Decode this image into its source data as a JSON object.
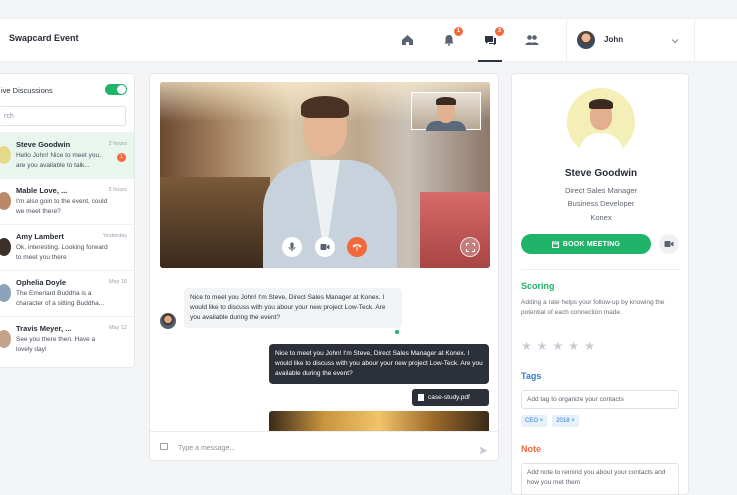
{
  "header": {
    "brand": "Swapcard Event",
    "nav": [
      {
        "icon": "home-icon"
      },
      {
        "icon": "bell-icon",
        "badge": "1"
      },
      {
        "icon": "chat-icon",
        "badge": "3"
      },
      {
        "icon": "people-icon"
      }
    ],
    "user": {
      "name": "John"
    }
  },
  "discussions": {
    "title": "ive Discussions",
    "live_toggle": true,
    "search_placeholder": "rch",
    "items": [
      {
        "name": "Steve Goodwin",
        "time": "2 hours",
        "message": "Hello John! Nice to meet you, are you available to talk...",
        "unread": "1",
        "active": true
      },
      {
        "name": "Mable Love, ...",
        "time": "5 hours",
        "message": "I'm also goin to the event, could we meet there?"
      },
      {
        "name": "Amy Lambert",
        "time": "Yesterday",
        "message": "Ok, interesting. Looking forward to meet you there"
      },
      {
        "name": "Ophelia Doyle",
        "time": "May 18",
        "message": "The Emerlard Buddha is a character of a sitting Buddha..."
      },
      {
        "name": "Travis Meyer, ...",
        "time": "May 12",
        "message": "See you there then. Have a lovely day!"
      }
    ]
  },
  "chat": {
    "message_in": "Nice to meet you John! I'm Steve, Direct Sales Manager at Konex. I would like to discuss with you abour your new project Low-Teck. Are you available during the event?",
    "message_out": "Nice to meet you John! I'm Steve, Direct Sales Manager at Konex. I would like to discuss with you abour your new project Low-Teck. Are you available during the event?",
    "file_name": "case-study.pdf",
    "composer_placeholder": "Type a message..."
  },
  "profile": {
    "name": "Steve Goodwin",
    "title": "Direct Sales Manager",
    "role": "Business Developer",
    "company": "Konex",
    "book_label": "BOOK MEETING",
    "scoring": {
      "title": "Scoring",
      "desc": "Adding a rate helps your follow-up by knowing the potential of each connection made.",
      "stars": 5,
      "rating": 0
    },
    "tags": {
      "title": "Tags",
      "placeholder": "Add tag to organize your contacts",
      "items": [
        "CEO ×",
        "2018 ×"
      ]
    },
    "note": {
      "title": "Note",
      "placeholder": "Add note to remind you about your contacts and how you met them"
    }
  },
  "colors": {
    "accent_green": "#20b46a",
    "accent_orange": "#f26a3b",
    "accent_blue": "#2f7fd0",
    "dark": "#2c3038"
  }
}
